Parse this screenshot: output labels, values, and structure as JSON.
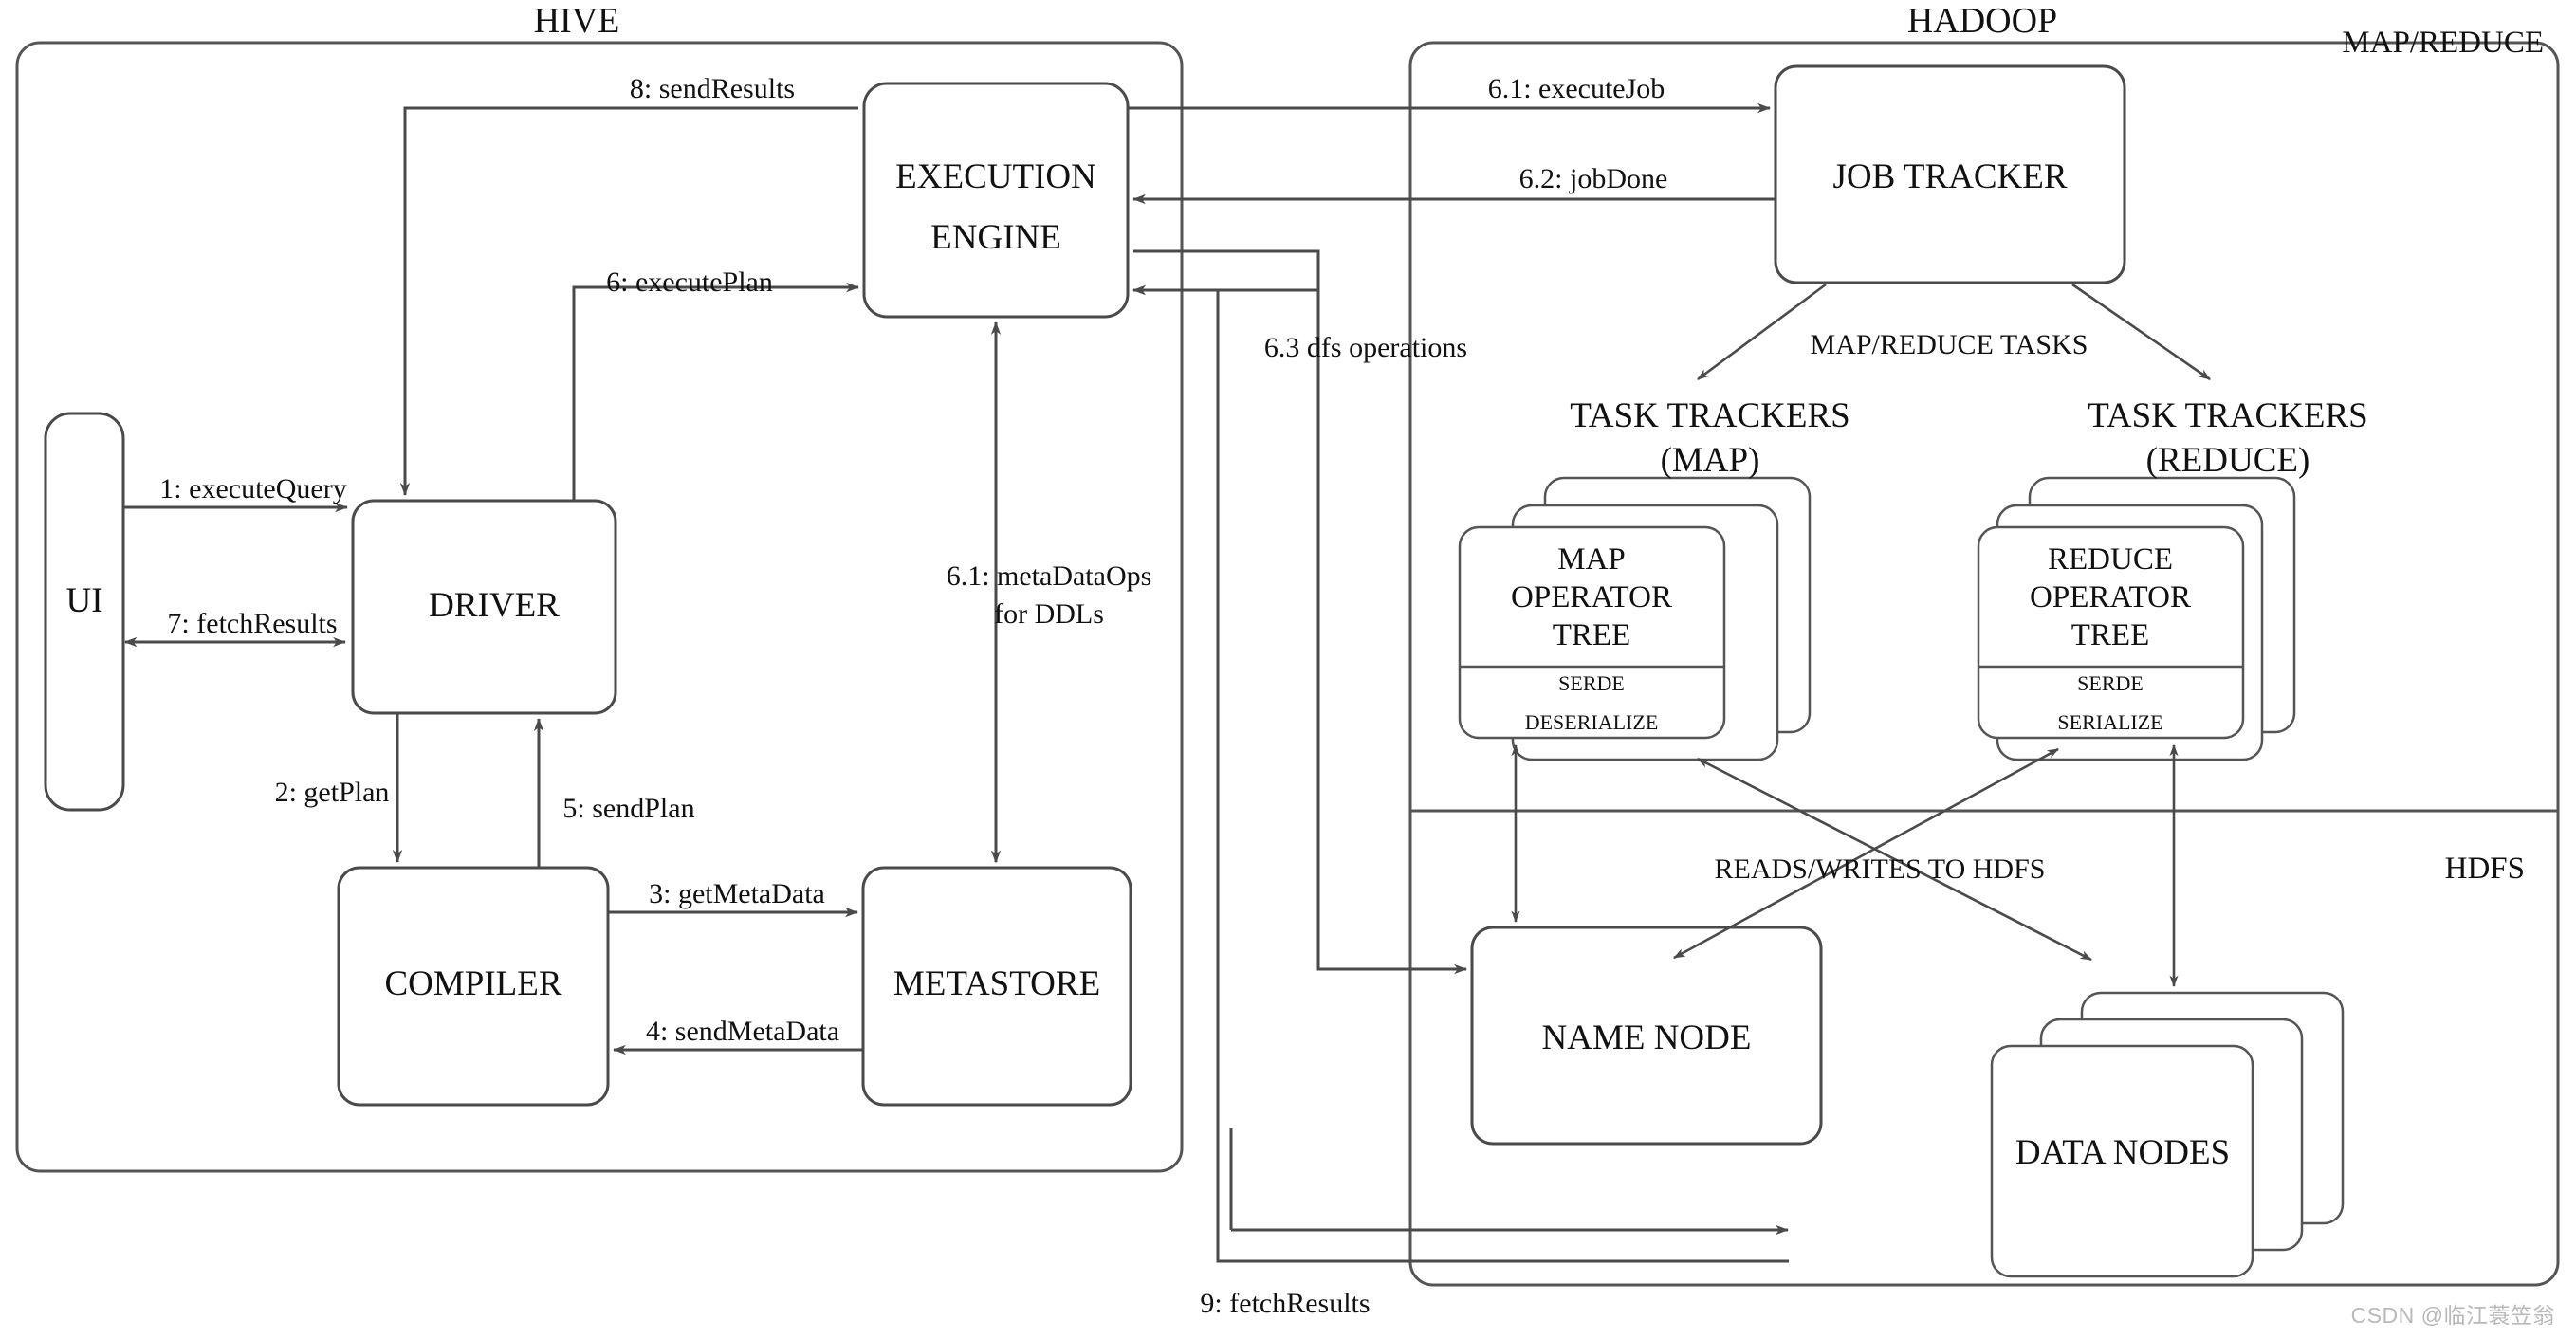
{
  "diagram": {
    "title_hive": "HIVE",
    "title_hadoop": "HADOOP",
    "corner_mapreduce": "MAP/REDUCE",
    "corner_hdfs": "HDFS"
  },
  "nodes": {
    "ui": "UI",
    "driver": "DRIVER",
    "compiler": "COMPILER",
    "metastore": "METASTORE",
    "execution_engine_line1": "EXECUTION",
    "execution_engine_line2": "ENGINE",
    "job_tracker": "JOB TRACKER",
    "task_trackers_map_line1": "TASK TRACKERS",
    "task_trackers_map_line2": "(MAP)",
    "task_trackers_reduce_line1": "TASK TRACKERS",
    "task_trackers_reduce_line2": "(REDUCE)",
    "map_operator_line1": "MAP",
    "map_operator_line2": "OPERATOR",
    "map_operator_line3": "TREE",
    "map_serde_line1": "SERDE",
    "map_serde_line2": "DESERIALIZE",
    "reduce_operator_line1": "REDUCE",
    "reduce_operator_line2": "OPERATOR",
    "reduce_operator_line3": "TREE",
    "reduce_serde_line1": "SERDE",
    "reduce_serde_line2": "SERIALIZE",
    "name_node": "NAME NODE",
    "data_nodes": "DATA NODES"
  },
  "edges": {
    "e1": "1: executeQuery",
    "e2": "2: getPlan",
    "e3": "3: getMetaData",
    "e4": "4: sendMetaData",
    "e5": "5: sendPlan",
    "e6": "6: executePlan",
    "e61_meta_line1": "6.1: metaDataOps",
    "e61_meta_line2": "for DDLs",
    "e61_job": "6.1: executeJob",
    "e62": "6.2: jobDone",
    "e63": "6.3 dfs operations",
    "e7": "7: fetchResults",
    "e8": "8: sendResults",
    "e9": "9: fetchResults",
    "mapreduce_tasks": "MAP/REDUCE TASKS",
    "reads_writes": "READS/WRITES TO HDFS"
  },
  "watermark": "CSDN @临江蓑笠翁",
  "colors": {
    "stroke": "#4a4a4a",
    "background": "#ffffff",
    "text": "#111111",
    "watermark": "#b9b9b9"
  }
}
